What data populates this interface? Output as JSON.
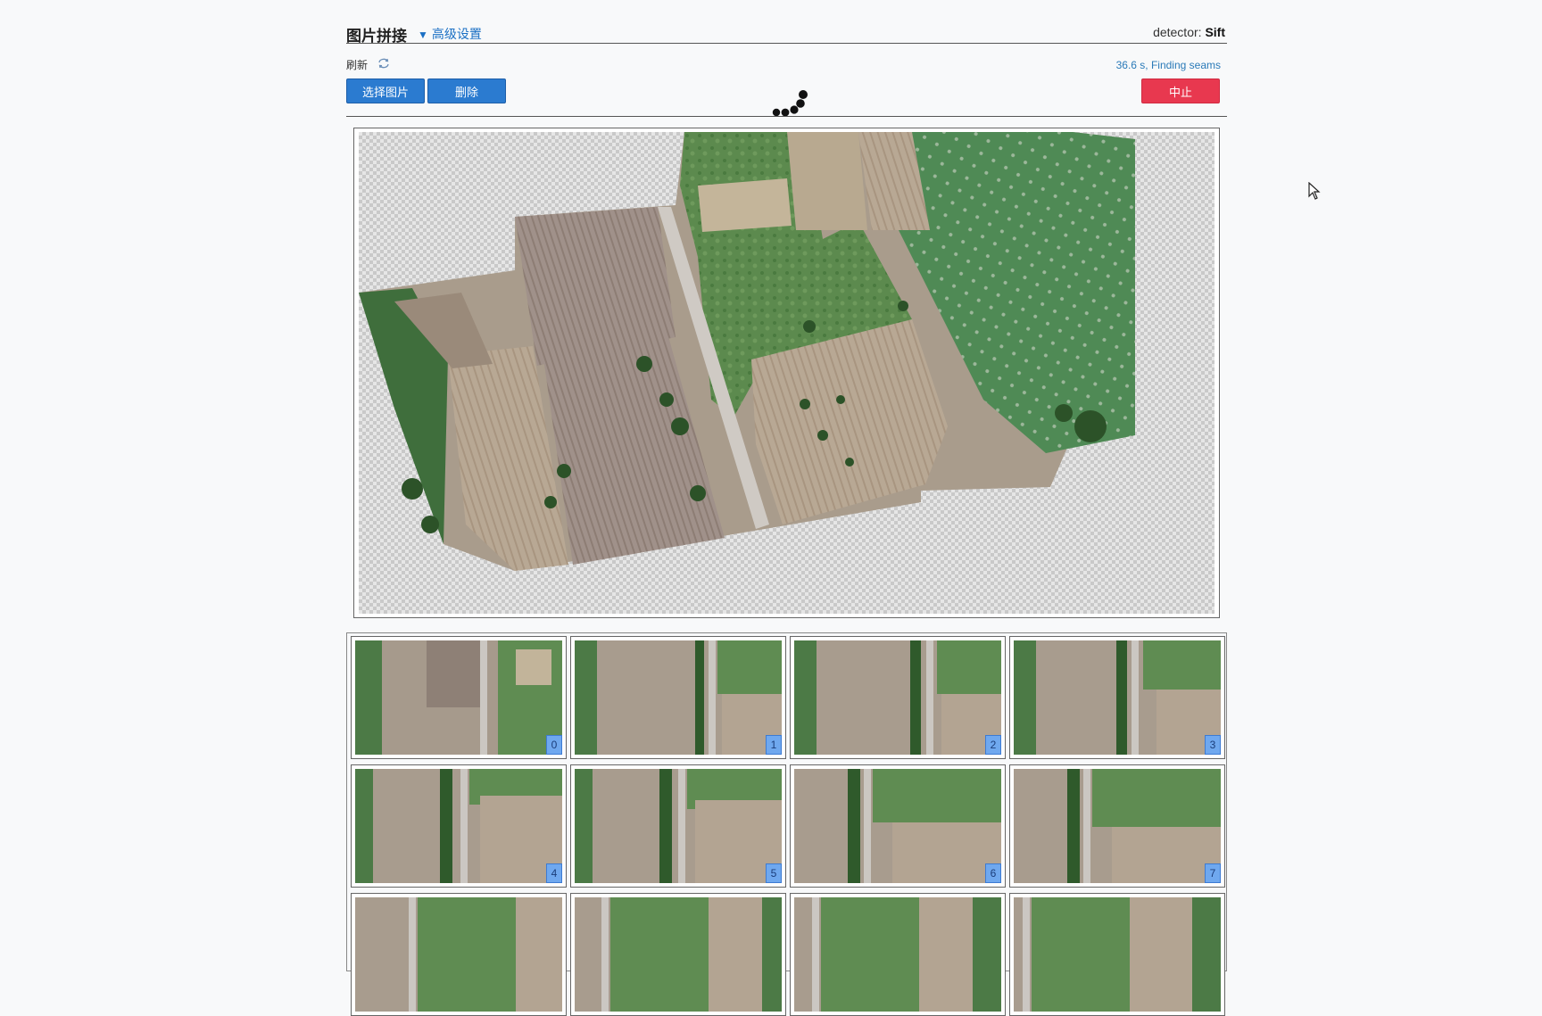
{
  "header": {
    "title": "图片拼接",
    "advanced_label": "高级设置",
    "advanced_arrow": "▼",
    "detector_label": "detector:",
    "detector_value": "Sift"
  },
  "toolbar": {
    "refresh_label": "刷新",
    "refresh_icon": "refresh-icon",
    "select_label": "选择图片",
    "delete_label": "删除",
    "abort_label": "中止",
    "status_text": "36.6 s, Finding seams"
  },
  "colors": {
    "primary": "#2b7bd0",
    "danger": "#e8384f",
    "link": "#1a6fc4",
    "index_badge": "#6fa8ef"
  },
  "thumbnails": [
    {
      "index": "0"
    },
    {
      "index": "1"
    },
    {
      "index": "2"
    },
    {
      "index": "3"
    },
    {
      "index": "4"
    },
    {
      "index": "5"
    },
    {
      "index": "6"
    },
    {
      "index": "7"
    },
    {
      "index": ""
    },
    {
      "index": ""
    },
    {
      "index": ""
    },
    {
      "index": ""
    }
  ]
}
